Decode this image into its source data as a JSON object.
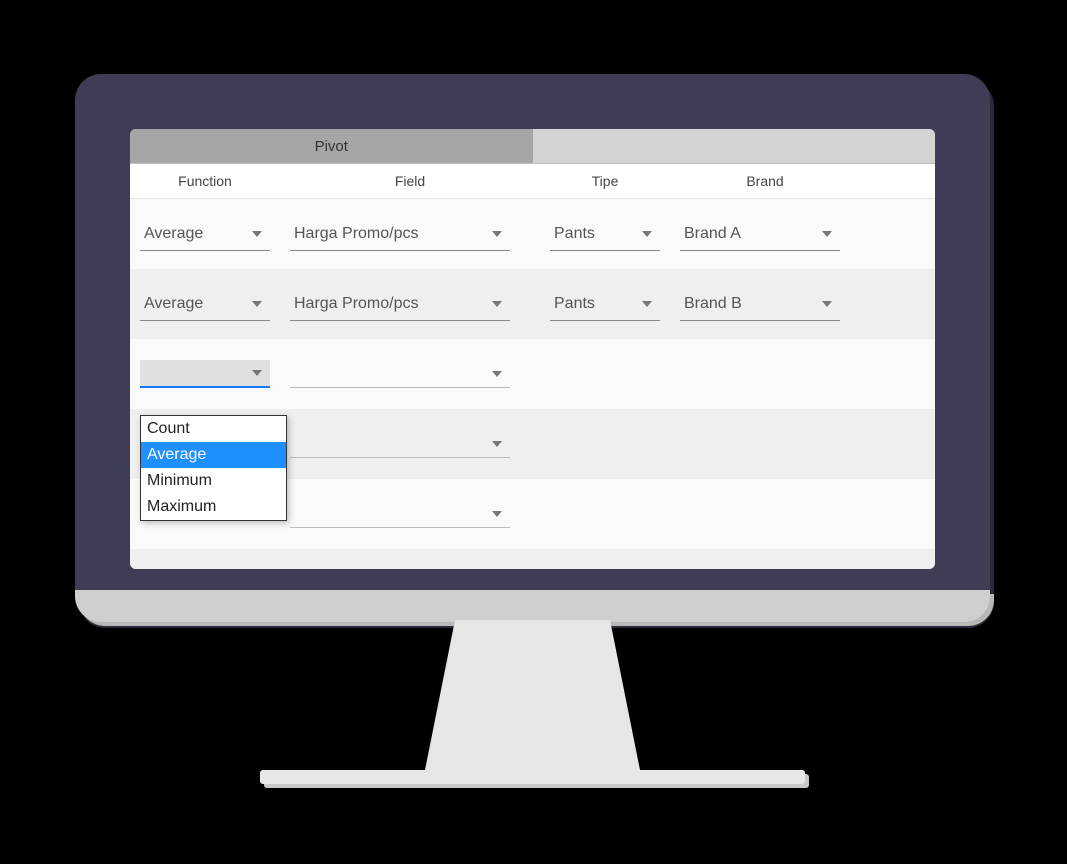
{
  "tab": {
    "active": "Pivot"
  },
  "columns": {
    "function": "Function",
    "field": "Field",
    "tipe": "Tipe",
    "brand": "Brand"
  },
  "rows": [
    {
      "function": "Average",
      "field": "Harga Promo/pcs",
      "tipe": "Pants",
      "brand": "Brand A"
    },
    {
      "function": "Average",
      "field": "Harga Promo/pcs",
      "tipe": "Pants",
      "brand": "Brand B"
    },
    {
      "function": "",
      "field": "",
      "tipe": "",
      "brand": ""
    },
    {
      "function": "",
      "field": "",
      "tipe": "",
      "brand": ""
    },
    {
      "function": "",
      "field": "",
      "tipe": "",
      "brand": ""
    },
    {
      "function": "",
      "field": "",
      "tipe": "",
      "brand": ""
    }
  ],
  "dropdown_open": {
    "row_index": 2,
    "column": "function",
    "selected": "Average",
    "options": [
      "Count",
      "Average",
      "Minimum",
      "Maximum"
    ]
  }
}
